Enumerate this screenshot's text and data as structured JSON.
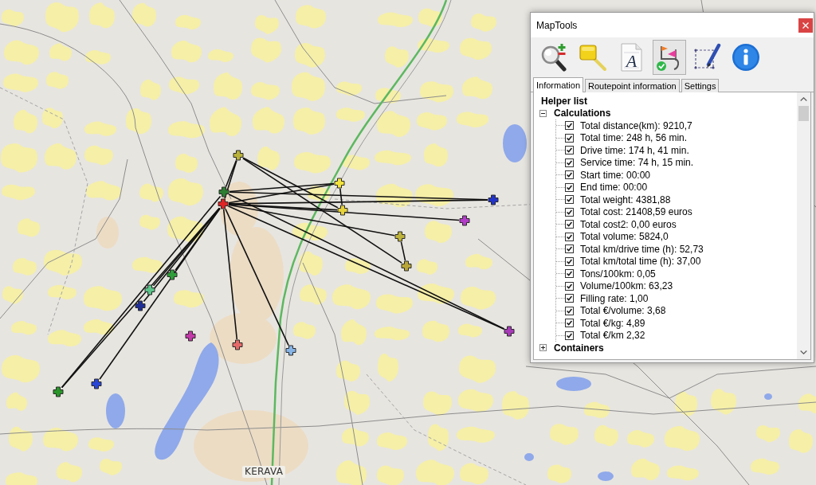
{
  "map": {
    "place_label": "KERAVA",
    "markers": [
      {
        "color": "#b9b23a"
      },
      {
        "color": "#2e7d32"
      },
      {
        "color": "#e02424"
      },
      {
        "color": "#f2e23c"
      },
      {
        "color": "#e6d23a"
      },
      {
        "color": "#2233c8"
      },
      {
        "color": "#b23cc8"
      },
      {
        "color": "#bdb33c"
      },
      {
        "color": "#b8a638"
      },
      {
        "color": "#a83ab8"
      },
      {
        "color": "#2f9e3a"
      },
      {
        "color": "#5cc48a"
      },
      {
        "color": "#1f2f96"
      },
      {
        "color": "#c23aa8"
      },
      {
        "color": "#e46a6a"
      },
      {
        "color": "#86b4e6"
      },
      {
        "color": "#2a962a"
      },
      {
        "color": "#2846d6"
      }
    ]
  },
  "window": {
    "title": "MapTools"
  },
  "toolbar": {
    "tools": [
      {
        "selected": false
      },
      {
        "selected": false
      },
      {
        "selected": false,
        "glyph": "A"
      },
      {
        "selected": true
      },
      {
        "selected": false
      },
      {
        "selected": false
      }
    ]
  },
  "tabs": [
    {
      "label": "Information",
      "selected": true
    },
    {
      "label": "Routepoint information",
      "selected": false
    },
    {
      "label": "Settings",
      "selected": false
    }
  ],
  "helper_list": {
    "title": "Helper list",
    "nodes": [
      {
        "label": "Calculations",
        "expanded": true,
        "children": [
          {
            "label": "Total distance(km): 9210,7",
            "checked": true
          },
          {
            "label": "Total time: 248 h, 56 min.",
            "checked": true
          },
          {
            "label": "Drive time: 174 h, 41 min.",
            "checked": true
          },
          {
            "label": "Service time: 74 h, 15 min.",
            "checked": true
          },
          {
            "label": "Start time: 00:00",
            "checked": true
          },
          {
            "label": "End time: 00:00",
            "checked": true
          },
          {
            "label": "Total weight: 4381,88",
            "checked": true
          },
          {
            "label": "Total cost: 21408,59 euros",
            "checked": true
          },
          {
            "label": "Total cost2: 0,00 euros",
            "checked": true
          },
          {
            "label": "Total volume: 5824,0",
            "checked": true
          },
          {
            "label": "Total km/drive time (h): 52,73",
            "checked": true
          },
          {
            "label": "Total km/total time (h): 37,00",
            "checked": true
          },
          {
            "label": "Tons/100km: 0,05",
            "checked": true
          },
          {
            "label": "Volume/100km: 63,23",
            "checked": true
          },
          {
            "label": "Filling rate: 1,00",
            "checked": true
          },
          {
            "label": "Total €/volume: 3,68",
            "checked": true
          },
          {
            "label": "Total €/kg: 4,89",
            "checked": true
          },
          {
            "label": "Total €/km 2,32",
            "checked": true
          }
        ]
      },
      {
        "label": "Containers",
        "expanded": false
      }
    ]
  }
}
